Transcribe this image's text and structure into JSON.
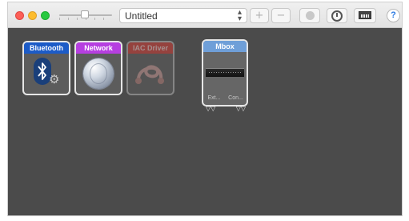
{
  "window": {
    "config_name": "Untitled",
    "zoom_level": 0.48
  },
  "toolbar": {
    "add_label": "+",
    "remove_label": "−",
    "help_label": "?",
    "icons": {
      "close": "close-icon",
      "minimize": "minimize-icon",
      "maximize": "maximize-icon",
      "chevron": "up-down-chevron-icon",
      "info": "info-icon",
      "clock": "clock-icon",
      "midi": "midi-keyboard-icon"
    }
  },
  "devices": [
    {
      "name": "Bluetooth",
      "icon": "bluetooth-icon",
      "color": "#1c5bc7",
      "state": "online"
    },
    {
      "name": "Network",
      "icon": "globe-icon",
      "color": "#b63fe0",
      "state": "online"
    },
    {
      "name": "IAC Driver",
      "icon": "midi-cable-icon",
      "color": "#d23b35",
      "state": "offline"
    },
    {
      "name": "Mbox",
      "icon": "audio-interface-icon",
      "color": "#6f9fd8",
      "state": "online",
      "ports": [
        "Ext...",
        "Con..."
      ]
    }
  ]
}
